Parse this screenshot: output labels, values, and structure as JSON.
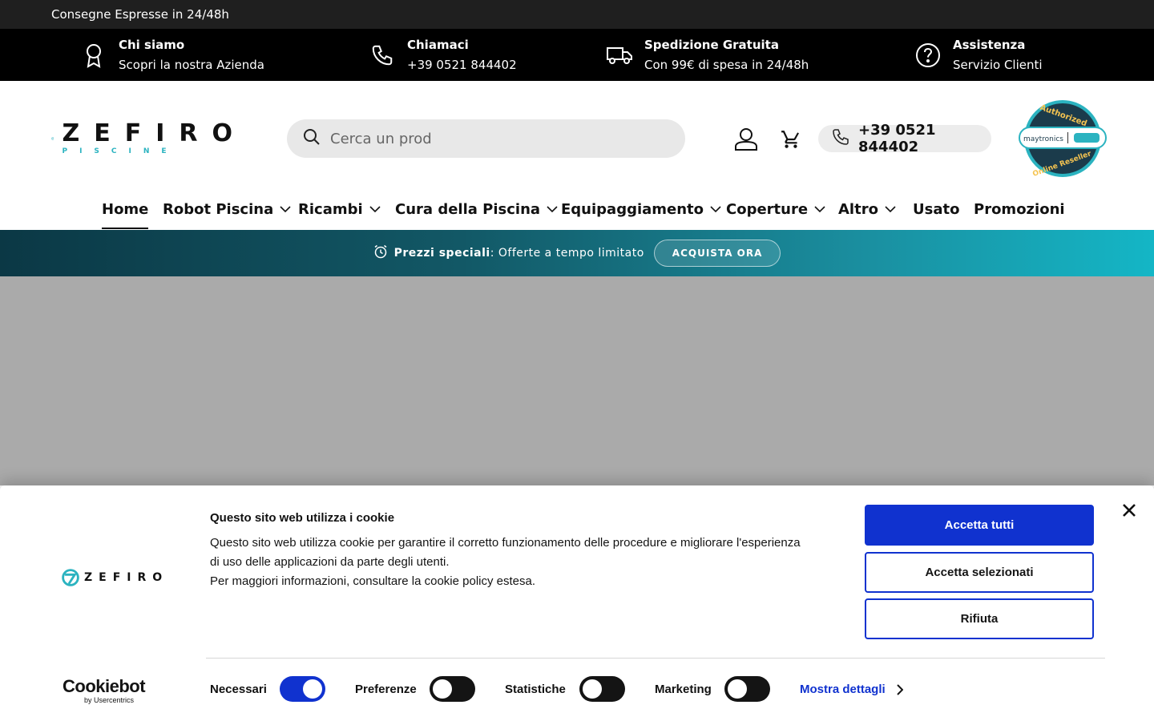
{
  "announcement": "Consegne Espresse in 24/48h",
  "infobar": [
    {
      "icon": "award-icon",
      "title": "Chi siamo",
      "subtitle": "Scopri la nostra Azienda"
    },
    {
      "icon": "phone-icon",
      "title": "Chiamaci",
      "subtitle": "+39 0521 844402"
    },
    {
      "icon": "truck-icon",
      "title": "Spedizione Gratuita",
      "subtitle": "Con 99€ di spesa in 24/48h"
    },
    {
      "icon": "help-circle-icon",
      "title": "Assistenza",
      "subtitle": "Servizio Clienti"
    }
  ],
  "header": {
    "logo_text": "ZEFIRO",
    "logo_sub": "PISCINE",
    "search_placeholder": "Cerca un prod",
    "phone": "+39 0521 844402",
    "badge_top": "Authorized",
    "badge_bottom": "Online Reseller",
    "badge_brand": "maytronics"
  },
  "nav": [
    {
      "label": "Home",
      "active": true
    },
    {
      "label": "Robot Piscina",
      "dropdown": true
    },
    {
      "label": "Ricambi",
      "dropdown": true
    },
    {
      "label": "Cura della Piscina",
      "dropdown": true
    },
    {
      "label": "Equipaggiamento",
      "dropdown": true
    },
    {
      "label": "Coperture",
      "dropdown": true
    },
    {
      "label": "Altro",
      "dropdown": true
    },
    {
      "label": "Usato"
    },
    {
      "label": "Promozioni"
    }
  ],
  "promo": {
    "bold": "Prezzi speciali",
    "text": ": Offerte a tempo limitato",
    "button": "ACQUISTA ORA"
  },
  "cookie": {
    "logo_text": "ZEFIRO",
    "title": "Questo sito web utilizza i cookie",
    "body_1": "Questo sito web utilizza cookie per garantire il corretto funzionamento delle procedure e migliorare l'esperienza di uso delle applicazioni da parte degli utenti.",
    "body_2": "Per maggiori informazioni, consultare la cookie policy estesa.",
    "accept_all": "Accetta tutti",
    "accept_selected": "Accetta selezionati",
    "reject": "Rifiuta",
    "toggles": [
      {
        "label": "Necessari",
        "on": true
      },
      {
        "label": "Preferenze",
        "on": false
      },
      {
        "label": "Statistiche",
        "on": false
      },
      {
        "label": "Marketing",
        "on": false
      }
    ],
    "details": "Mostra dettagli",
    "brand": "Cookiebot",
    "brand_sub": "by Usercentrics"
  },
  "colors": {
    "accent_blue": "#1032cf",
    "teal": "#2bb3c0",
    "hero_gray": "#aaaaaa"
  }
}
